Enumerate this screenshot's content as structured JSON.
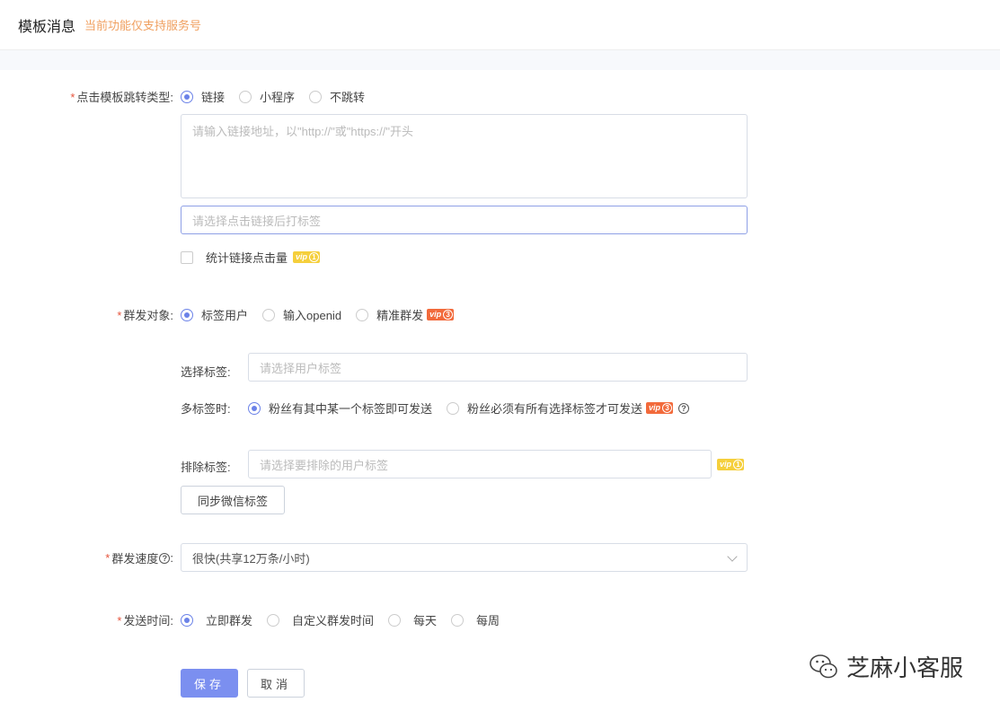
{
  "header": {
    "title": "模板消息",
    "subtitle": "当前功能仅支持服务号"
  },
  "jump_type": {
    "label": "点击模板跳转类型:",
    "options": [
      "链接",
      "小程序",
      "不跳转"
    ],
    "selected": 0,
    "link_placeholder": "请输入链接地址，以\"http://\"或\"https://\"开头",
    "tag_placeholder": "请选择点击链接后打标签",
    "count_clicks_label": "统计链接点击量",
    "vip_level": "1"
  },
  "target": {
    "label": "群发对象:",
    "options": [
      "标签用户",
      "输入openid",
      "精准群发"
    ],
    "selected": 0,
    "vip_level": "3",
    "select_tag_label": "选择标签:",
    "select_tag_placeholder": "请选择用户标签",
    "multi_tag_label": "多标签时:",
    "multi_tag_options": [
      "粉丝有其中某一个标签即可发送",
      "粉丝必须有所有选择标签才可发送"
    ],
    "multi_tag_selected": 0,
    "multi_tag_vip": "3",
    "exclude_label": "排除标签:",
    "exclude_placeholder": "请选择要排除的用户标签",
    "exclude_vip": "1",
    "sync_button": "同步微信标签"
  },
  "speed": {
    "label": "群发速度",
    "value": "很快(共享12万条/小时)"
  },
  "send_time": {
    "label": "发送时间:",
    "options": [
      "立即群发",
      "自定义群发时间",
      "每天",
      "每周"
    ],
    "selected": 0
  },
  "actions": {
    "save": "保存",
    "cancel": "取消"
  },
  "watermark": {
    "text": "芝麻小客服"
  },
  "vip_text": "vip",
  "colors": {
    "accent": "#6b82e8",
    "primary_button": "#7b8ff0",
    "required": "#e6543c",
    "subtitle": "#f0a060",
    "vip_yellow": "#f5cf3c",
    "vip_orange": "#f26a3b"
  }
}
